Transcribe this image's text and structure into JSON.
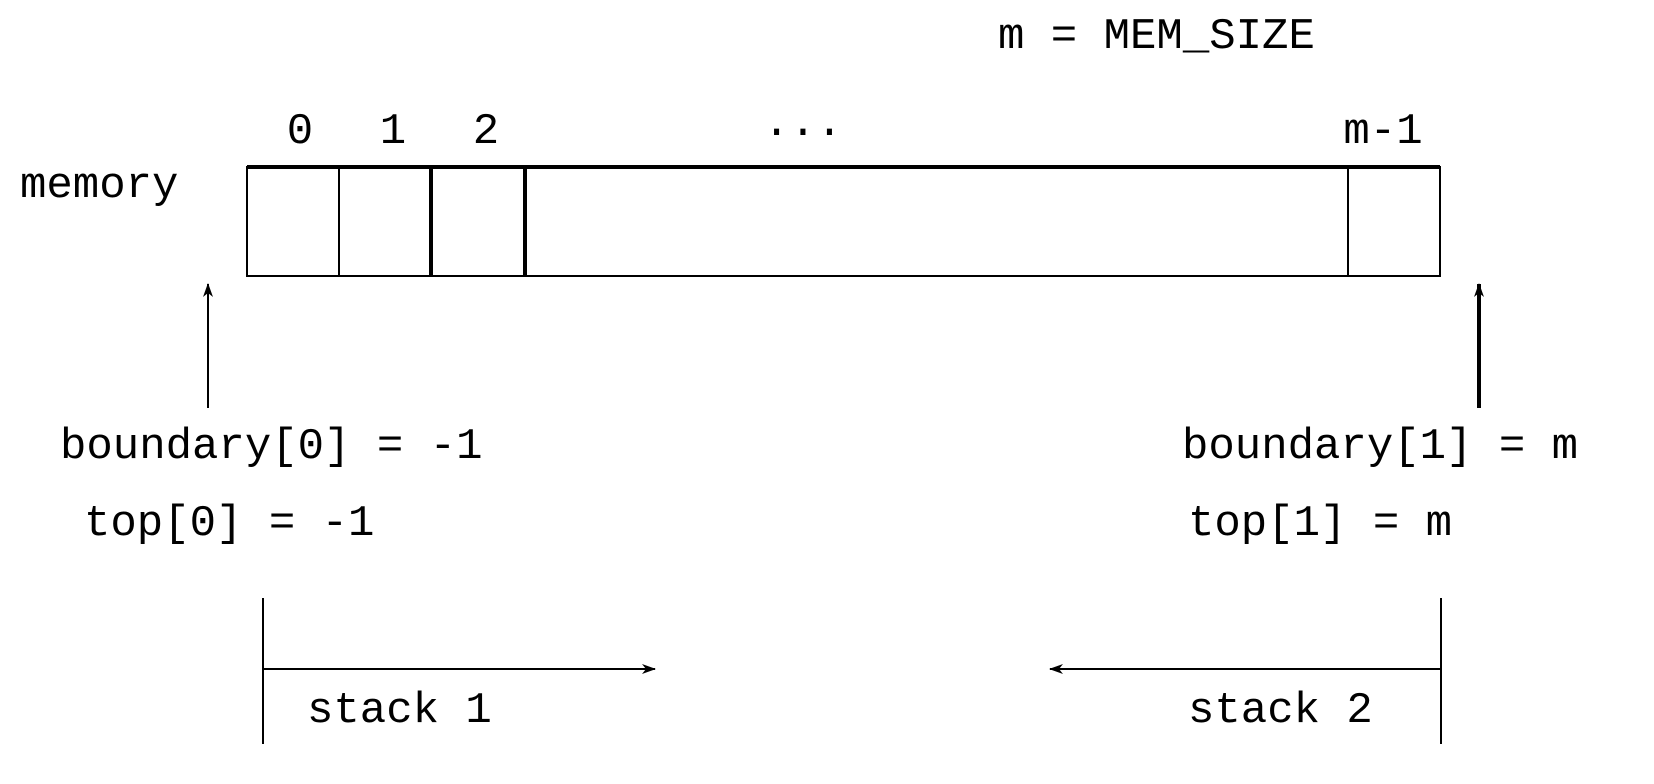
{
  "title_text": "m = MEM_SIZE",
  "memory": {
    "label": "memory",
    "index_labels": [
      "0",
      "1",
      "2"
    ],
    "ellipsis": "...",
    "last_index_label": "m-1"
  },
  "left_pointer": {
    "boundary_text": "boundary[0] = -1",
    "top_text": "top[0] = -1"
  },
  "right_pointer": {
    "boundary_text": "boundary[1] = m",
    "top_text": "top[1] = m"
  },
  "stacks": [
    {
      "label": "stack 1",
      "direction": "right"
    },
    {
      "label": "stack 2",
      "direction": "left"
    }
  ],
  "colors": {
    "stroke": "#000000",
    "background": "#ffffff"
  }
}
